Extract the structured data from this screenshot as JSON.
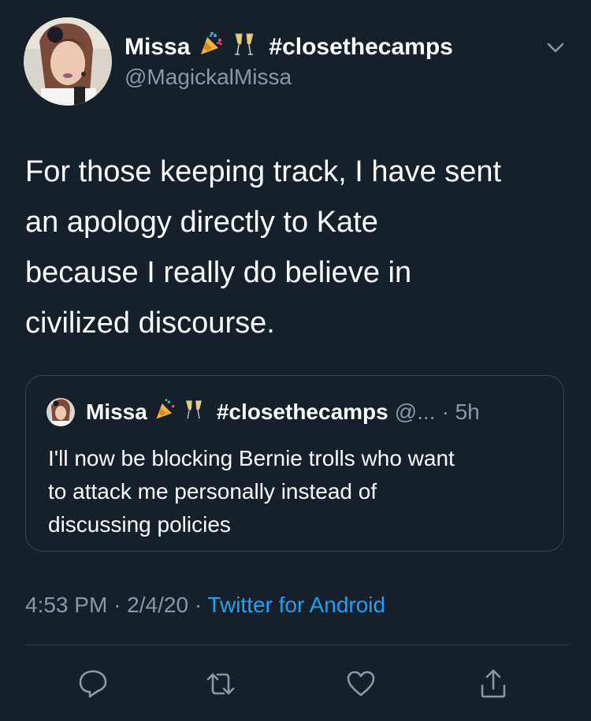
{
  "author": {
    "display_name": "Missa",
    "hashtag": "#closethecamps",
    "handle": "@MagickalMissa",
    "emoji_icons": [
      "party-popper-icon",
      "clinking-glasses-icon"
    ]
  },
  "tweet": {
    "lines": [
      "For those keeping track, I have sent",
      "an apology directly to Kate",
      "because I really do believe in",
      "civilized discourse."
    ]
  },
  "quoted_tweet": {
    "display_name": "Missa",
    "hashtag": "#closethecamps",
    "handle_truncated": "@...",
    "time": "· 5h",
    "lines": [
      "I'll now be blocking Bernie trolls who want",
      "to attack me personally instead of",
      "discussing policies"
    ]
  },
  "meta": {
    "time": "4:53 PM",
    "sep1": "·",
    "date": "2/4/20",
    "sep2": "·",
    "source": "Twitter for Android"
  },
  "actions": [
    "reply-icon",
    "retweet-icon",
    "like-icon",
    "share-icon"
  ],
  "colors": {
    "background": "#15202b",
    "text": "#ffffff",
    "muted": "#8899a6",
    "link": "#1da1f2",
    "border": "#38444d"
  }
}
